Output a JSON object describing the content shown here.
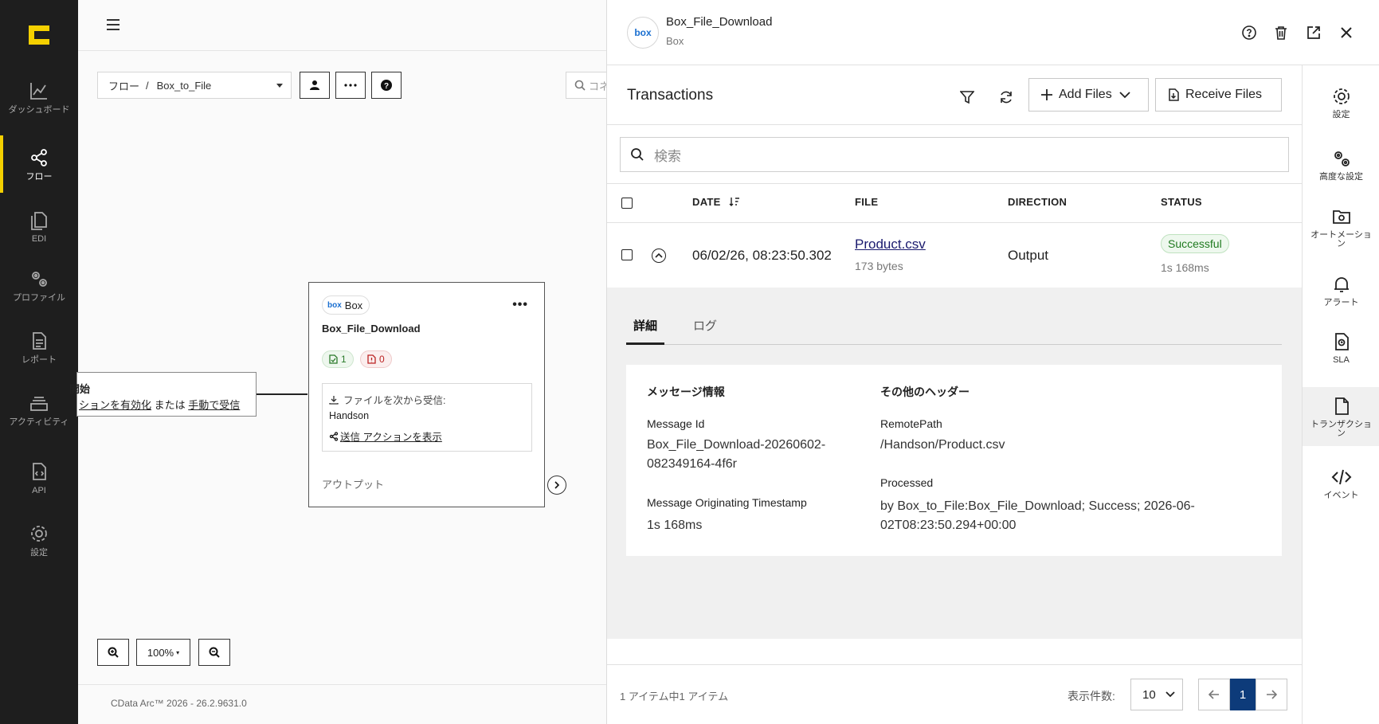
{
  "nav": {
    "items": [
      {
        "label": "ダッシュボード",
        "icon": "chart-line-icon"
      },
      {
        "label": "フロー",
        "icon": "share-nodes-icon"
      },
      {
        "label": "EDI",
        "icon": "documents-icon"
      },
      {
        "label": "プロファイル",
        "icon": "gears-icon"
      },
      {
        "label": "レポート",
        "icon": "report-icon"
      },
      {
        "label": "アクティビティ",
        "icon": "layers-icon"
      },
      {
        "label": "API",
        "icon": "api-file-icon"
      },
      {
        "label": "設定",
        "icon": "gear-icon"
      }
    ],
    "active": "フロー",
    "accent": "#f4d000"
  },
  "canvas": {
    "breadcrumb_root": "フロー",
    "breadcrumb_sep": "/",
    "breadcrumb_current": "Box_to_File",
    "search_placeholder": "コネ",
    "start_node": {
      "title": "開始",
      "line_prefix": "ションを",
      "link_enable": "有効化",
      "line_mid": " または ",
      "link_manual": "手動で受信"
    },
    "box_node": {
      "tag": "Box",
      "tag_logo": "box",
      "title": "Box_File_Download",
      "success_count": "1",
      "error_count": "0",
      "receive_label": "ファイルを次から受信:",
      "receive_value": "Handson",
      "send_action_link": "送信 アクションを表示",
      "output_label": "アウトプット"
    },
    "zoom_level": "100%",
    "version": "CData Arc™ 2026 - 26.2.9631.0"
  },
  "panel": {
    "logo": "box",
    "title": "Box_File_Download",
    "subtitle": "Box",
    "section_title": "Transactions",
    "add_files": "Add Files",
    "receive_files": "Receive Files",
    "search_placeholder": "検索",
    "columns": {
      "date": "DATE",
      "file": "FILE",
      "direction": "DIRECTION",
      "status": "STATUS"
    },
    "rows": [
      {
        "date": "06/02/26, 08:23:50.302",
        "file": "Product.csv",
        "size": "173 bytes",
        "direction": "Output",
        "status": "Successful",
        "duration": "1s 168ms"
      }
    ],
    "tabs": [
      "詳細",
      "ログ"
    ],
    "detail": {
      "message_info_title": "メッセージ情報",
      "other_headers_title": "その他のヘッダー",
      "message_id_label": "Message Id",
      "message_id_line1": "Box_File_Download-20260602-",
      "message_id_line2": "082349164-4f6r",
      "timestamp_label": "Message Originating Timestamp",
      "timestamp_value": "1s 168ms",
      "remote_path_label": "RemotePath",
      "remote_path_value": "/Handson/Product.csv",
      "processed_label": "Processed",
      "processed_line1": "by Box_to_File:Box_File_Download; Success; 2026-06-",
      "processed_line2": "02T08:23:50.294+00:00"
    },
    "footer": {
      "count_text": "1 アイテム中1 アイテム",
      "per_page_label": "表示件数:",
      "per_page_value": "10",
      "current_page": "1"
    },
    "rail": [
      {
        "label": "設定",
        "icon": "gear-icon"
      },
      {
        "label": "高度な設定",
        "icon": "gears-icon"
      },
      {
        "label": "オートメーション",
        "icon": "folder-gear-icon"
      },
      {
        "label": "アラート",
        "icon": "bell-icon"
      },
      {
        "label": "SLA",
        "icon": "sla-file-icon"
      },
      {
        "label": "トランザクション",
        "icon": "file-icon"
      },
      {
        "label": "イベント",
        "icon": "code-icon"
      }
    ],
    "colors": {
      "success": "#1f7a1f",
      "page_active": "#0d3b7a"
    }
  }
}
